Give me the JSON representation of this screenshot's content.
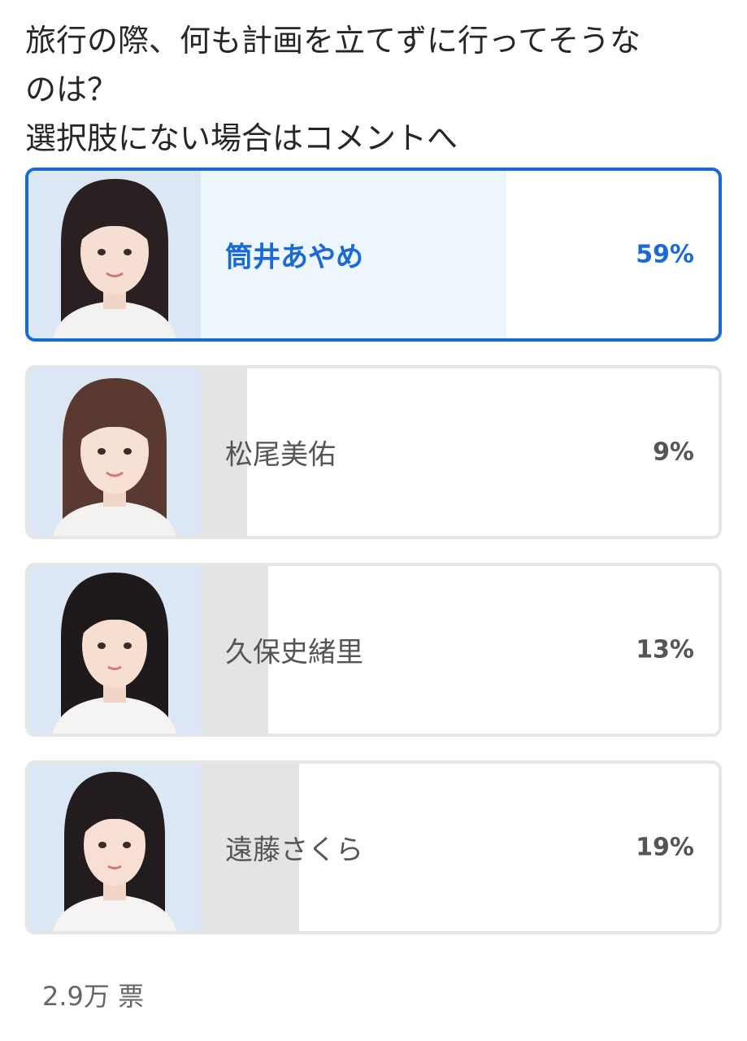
{
  "question": {
    "lines": [
      "旅行の際、何も計画を立てずに行ってそうな",
      "のは？",
      "選択肢にない場合はコメントへ"
    ]
  },
  "options": [
    {
      "name": "筒井あやめ",
      "percent_label": "59%",
      "percent": 59,
      "selected": true,
      "photo_icon": "member-photo"
    },
    {
      "name": "松尾美佑",
      "percent_label": "9%",
      "percent": 9,
      "selected": false,
      "photo_icon": "member-photo"
    },
    {
      "name": "久保史緒里",
      "percent_label": "13%",
      "percent": 13,
      "selected": false,
      "photo_icon": "member-photo"
    },
    {
      "name": "遠藤さくら",
      "percent_label": "19%",
      "percent": 19,
      "selected": false,
      "photo_icon": "member-photo"
    }
  ],
  "votes": {
    "label": "2.9万 票"
  },
  "colors": {
    "accent": "#1a6ad6",
    "selected_fill": "#edf5fd",
    "result_fill": "#e4e4e4",
    "border": "#e6e6e6",
    "photo_background": "#dbe7f5"
  }
}
